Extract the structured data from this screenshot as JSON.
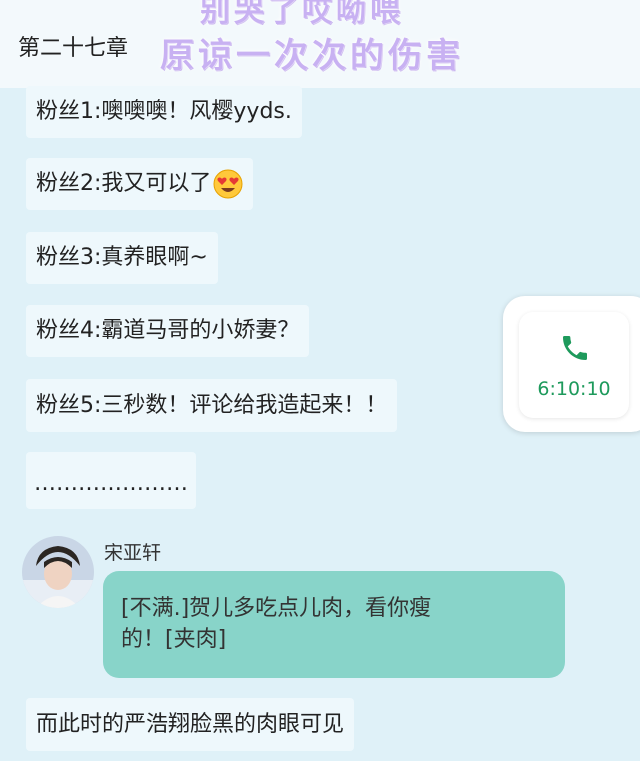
{
  "header": {
    "chapter_title": "第二十七章",
    "overlay_line1": "别哭了哎呦喂",
    "overlay_line2": "原谅一次次的伤害"
  },
  "messages": [
    {
      "text": "粉丝1:噢噢噢！风樱yyds."
    },
    {
      "text": "粉丝2:我又可以了",
      "emoji": "heart-eyes-emoji"
    },
    {
      "text": "粉丝3:真养眼啊~"
    },
    {
      "text": "粉丝4:霸道马哥的小娇妻？"
    },
    {
      "text": "粉丝5:三秒数！评论给我造起来！！"
    },
    {
      "text": "…………………"
    }
  ],
  "call_widget": {
    "icon": "phone-icon",
    "duration": "6:10:10",
    "accent_color": "#1e9a5c"
  },
  "chat": {
    "sender_name": "宋亚轩",
    "avatar_icon": "avatar",
    "bubble_line1": "[不满.]贺儿多吃点儿肉，看你瘦",
    "bubble_line2": "的！[夹肉]",
    "bubble_color": "#88d4c9"
  },
  "narration": {
    "text": "而此时的严浩翔脸黑的肉眼可见"
  }
}
